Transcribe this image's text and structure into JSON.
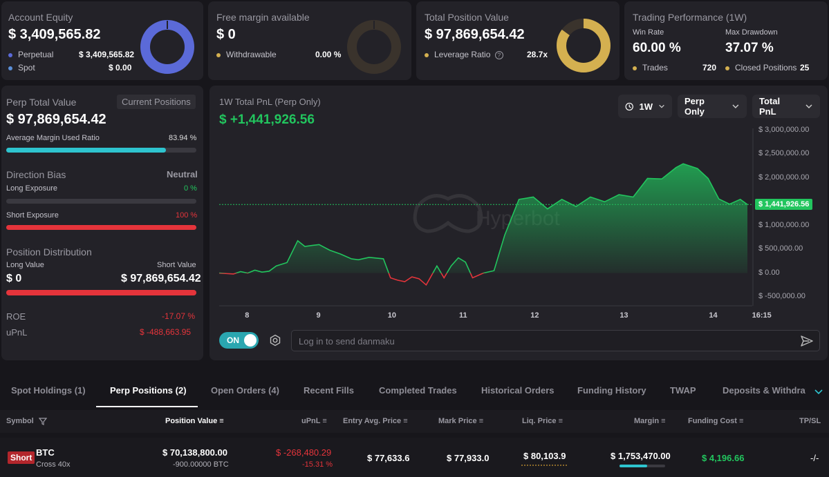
{
  "equity": {
    "title": "Account Equity",
    "value": "$ 3,409,565.82",
    "rows": [
      {
        "label": "Perpetual",
        "value": "$ 3,409,565.82"
      },
      {
        "label": "Spot",
        "value": "$ 0.00"
      }
    ],
    "colors": {
      "perp": "#5b6ad8",
      "spot": "#5b8fd8"
    }
  },
  "free_margin": {
    "title": "Free margin available",
    "value": "$ 0",
    "row": {
      "label": "Withdrawable",
      "value": "0.00 %"
    },
    "ring_level": 0
  },
  "position_value": {
    "title": "Total Position Value",
    "value": "$ 97,869,654.42",
    "row": {
      "label": "Leverage Ratio",
      "value": "28.7x"
    },
    "ring_level": 0.85,
    "color": "#d4b050"
  },
  "performance": {
    "title": "Trading Performance (1W)",
    "win_rate_label": "Win Rate",
    "win_rate": "60.00 %",
    "drawdown_label": "Max Drawdown",
    "drawdown": "37.07 %",
    "trades_label": "Trades",
    "trades": "720",
    "closed_label": "Closed Positions",
    "closed": "25"
  },
  "perp_panel": {
    "title": "Perp Total Value",
    "current_positions_label": "Current Positions",
    "value": "$ 97,869,654.42",
    "margin_label": "Average Margin Used Ratio",
    "margin_value": "83.94 %",
    "margin_level": 0.8394,
    "bias_label": "Direction Bias",
    "bias_value": "Neutral",
    "long_label": "Long Exposure",
    "long_value": "0 %",
    "long_level": 0,
    "short_label": "Short Exposure",
    "short_value": "100 %",
    "short_level": 1.0,
    "dist_label": "Position Distribution",
    "long_value_label": "Long Value",
    "short_value_label": "Short Value",
    "long_amount": "$ 0",
    "short_amount": "$ 97,869,654.42",
    "dist_short_level": 1.0,
    "roe_label": "ROE",
    "roe_value": "-17.07 %",
    "upnl_label": "uPnL",
    "upnl_value": "$ -488,663.95"
  },
  "chart_panel": {
    "title": "1W Total PnL (Perp Only)",
    "pnl": "$ +1,441,926.56",
    "dropdowns": [
      "1W",
      "Perp Only",
      "Total PnL"
    ],
    "current_tag": "$ 1,441,926.56",
    "watermark": "Hyperbot",
    "toggle_label": "ON",
    "danmaku_placeholder": "Log in to send danmaku"
  },
  "chart_data": {
    "type": "area",
    "title": "1W Total PnL (Perp Only)",
    "x_ticks": [
      "8",
      "9",
      "10",
      "11",
      "12",
      "13",
      "14",
      "16:15"
    ],
    "y_ticks": [
      "$ 3,000,000.00",
      "$ 2,500,000.00",
      "$ 2,000,000.00",
      "$ 1,500,000.00",
      "$ 1,000,000.00",
      "$ 500,000.00",
      "$ 0.00",
      "$ -500,000.00"
    ],
    "ylim": [
      -500000,
      3000000
    ],
    "x_days": [
      7.6,
      7.8,
      7.9,
      8.0,
      8.1,
      8.2,
      8.3,
      8.4,
      8.55,
      8.7,
      8.8,
      8.9,
      9.0,
      9.15,
      9.3,
      9.45,
      9.55,
      9.7,
      9.9,
      10.0,
      10.1,
      10.2,
      10.3,
      10.4,
      10.5,
      10.65,
      10.75,
      10.85,
      10.95,
      11.05,
      11.15,
      11.3,
      11.45,
      11.6,
      11.8,
      12.0,
      12.2,
      12.4,
      12.6,
      12.8,
      13.0,
      13.2,
      13.4,
      13.6,
      13.8,
      14.0,
      14.1,
      14.3,
      14.45,
      14.6,
      14.75,
      14.9,
      15.0
    ],
    "values": [
      0,
      -20000,
      30000,
      0,
      60000,
      20000,
      40000,
      150000,
      220000,
      680000,
      560000,
      580000,
      600000,
      480000,
      400000,
      300000,
      280000,
      330000,
      300000,
      -100000,
      -150000,
      -180000,
      -80000,
      -120000,
      -250000,
      150000,
      -100000,
      150000,
      320000,
      230000,
      -100000,
      0,
      50000,
      800000,
      1550000,
      1600000,
      1350000,
      1550000,
      1400000,
      1600000,
      1500000,
      1650000,
      1600000,
      1990000,
      1980000,
      2220000,
      2300000,
      2200000,
      1990000,
      1560000,
      1450000,
      1550000,
      1441926
    ],
    "current_value": 1441926.56,
    "colors": {
      "positive": "#22c55e",
      "negative": "#e5343b"
    }
  },
  "tabs": [
    "Spot Holdings (1)",
    "Perp Positions (2)",
    "Open Orders (4)",
    "Recent Fills",
    "Completed Trades",
    "Historical Orders",
    "Funding History",
    "TWAP",
    "Deposits & Withdraw"
  ],
  "table": {
    "headers": [
      "Symbol",
      "Position Value",
      "uPnL",
      "Entry Avg. Price",
      "Mark Price",
      "Liq. Price",
      "Margin",
      "Funding Cost",
      "TP/SL"
    ],
    "row": {
      "side": "Short",
      "symbol": "BTC",
      "leverage": "Cross 40x",
      "position_value": "$ 70,138,800.00",
      "position_size": "-900.00000 BTC",
      "upnl": "$ -268,480.29",
      "upnl_pct": "-15.31 %",
      "entry": "$ 77,633.6",
      "mark": "$ 77,933.0",
      "liq": "$ 80,103.9",
      "margin": "$ 1,753,470.00",
      "funding": "$ 4,196.66",
      "tpsl": "-/-"
    }
  }
}
